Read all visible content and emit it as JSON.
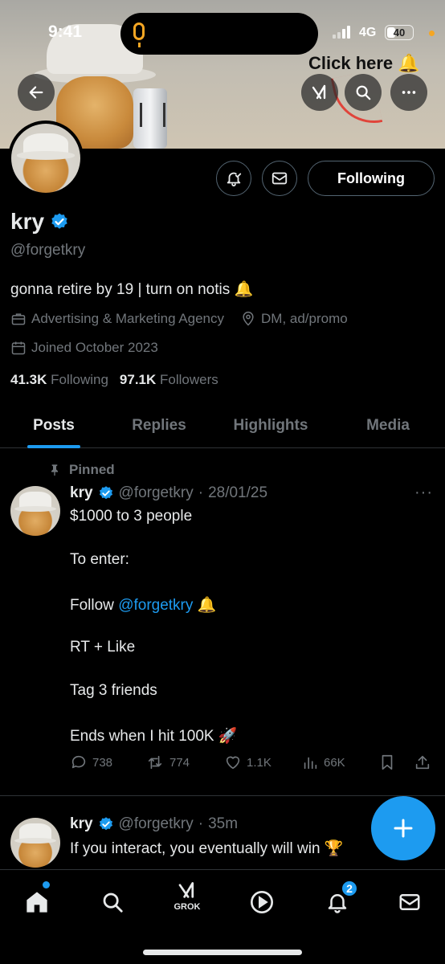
{
  "status_bar": {
    "time": "9:41",
    "network": "4G",
    "battery": "40",
    "battery_level": 0.4
  },
  "banner": {
    "callout": "Click here 🔔"
  },
  "profile": {
    "name": "kry",
    "handle": "@forgetkry",
    "bio": "gonna retire by 19  |  turn on notis 🔔",
    "category": "Advertising & Marketing Agency",
    "location": "DM, ad/promo",
    "joined": "Joined October 2023",
    "following_count": "41.3K",
    "following_label": "Following",
    "followers_count": "97.1K",
    "followers_label": "Followers",
    "follow_button": "Following"
  },
  "tabs": [
    {
      "label": "Posts",
      "active": true
    },
    {
      "label": "Replies",
      "active": false
    },
    {
      "label": "Highlights",
      "active": false
    },
    {
      "label": "Media",
      "active": false
    }
  ],
  "pinned_post": {
    "pinned_label": "Pinned",
    "name": "kry",
    "handle": "@forgetkry",
    "time": "28/01/25",
    "lines": {
      "l1": "$1000 to 3 people",
      "l2": "To enter:",
      "l3_prefix": "Follow ",
      "l3_mention": "@forgetkry",
      "l3_suffix": " 🔔",
      "l4": "RT + Like",
      "l5": "Tag 3 friends",
      "l6": "Ends when I hit 100K 🚀"
    },
    "stats": {
      "replies": "738",
      "reposts": "774",
      "likes": "1.1K",
      "views": "66K"
    }
  },
  "second_post": {
    "name": "kry",
    "handle": "@forgetkry",
    "time": "35m",
    "text": "If you interact, you eventually will win 🏆"
  },
  "bottom_nav": {
    "grok_label": "GROK",
    "notifications_badge": "2"
  },
  "colors": {
    "accent": "#1d9bf0",
    "background": "#000000",
    "muted": "#71767b",
    "text": "#e7e9ea"
  }
}
